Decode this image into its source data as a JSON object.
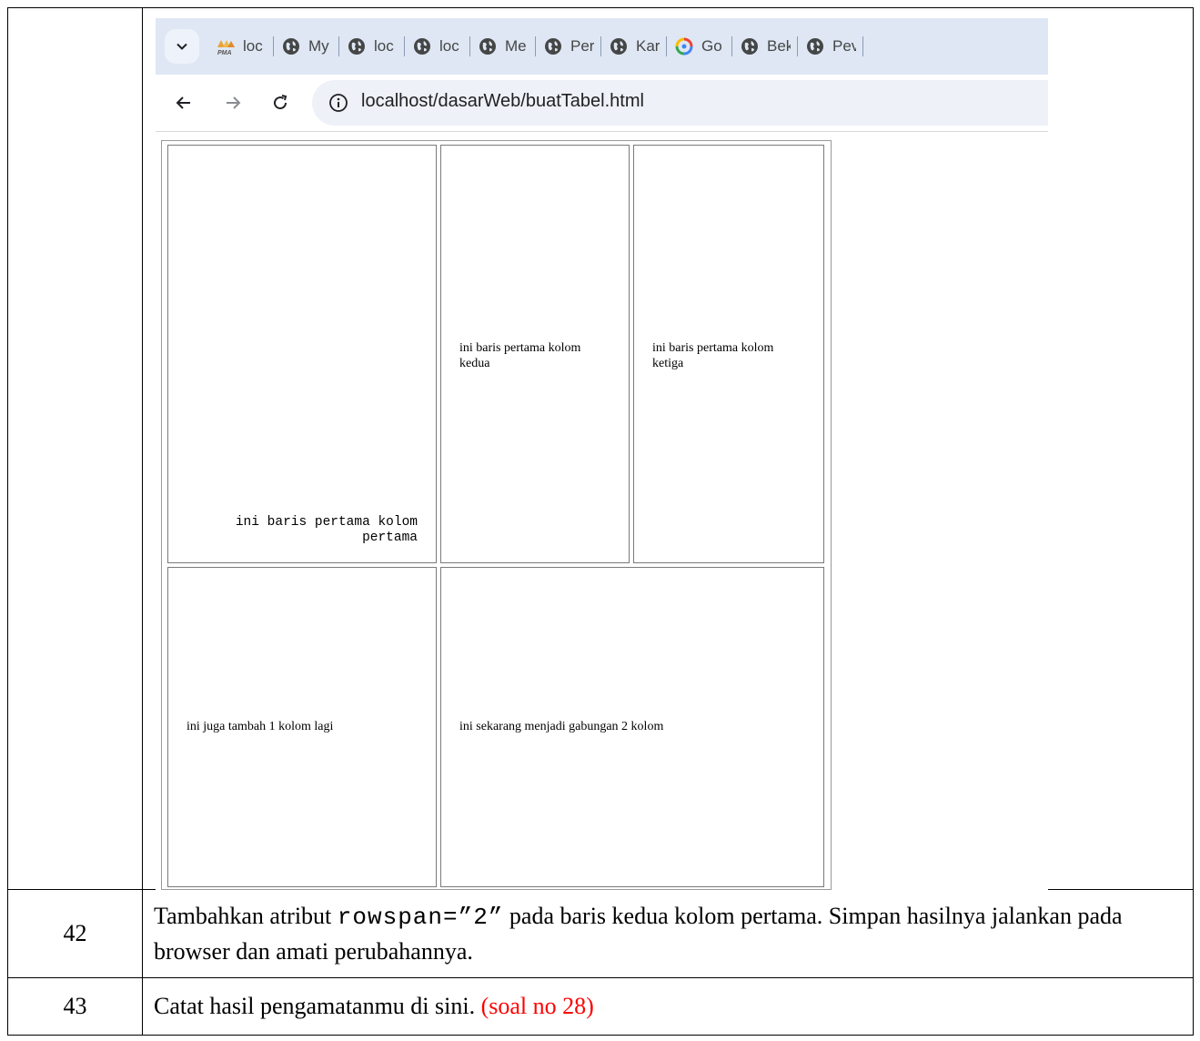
{
  "rows": [
    {
      "number": "",
      "kind": "screenshot"
    },
    {
      "number": "42",
      "text_before": "Tambahkan atribut ",
      "code": "rowspan=”2”",
      "text_after": " pada baris kedua kolom pertama. Simpan hasilnya jalankan pada browser dan amati perubahannya."
    },
    {
      "number": "43",
      "text": "Catat hasil pengamatanmu di sini. ",
      "note": "(soal no 28)"
    }
  ],
  "browser": {
    "tabs": [
      {
        "icon": "pma-icon",
        "label": "loc"
      },
      {
        "icon": "globe-icon",
        "label": "My"
      },
      {
        "icon": "globe-icon",
        "label": "loc"
      },
      {
        "icon": "globe-icon",
        "label": "loc"
      },
      {
        "icon": "globe-icon",
        "label": "Me"
      },
      {
        "icon": "globe-icon",
        "label": "Per"
      },
      {
        "icon": "globe-icon",
        "label": "Kar"
      },
      {
        "icon": "google-icon",
        "label": "Go"
      },
      {
        "icon": "globe-icon",
        "label": "Bek"
      },
      {
        "icon": "globe-icon",
        "label": "Pev"
      }
    ],
    "url": "localhost/dasarWeb/buatTabel.html",
    "table": {
      "r1c1": "ini baris pertama kolom pertama",
      "r1c2": "ini baris pertama kolom kedua",
      "r1c3": "ini baris pertama kolom ketiga",
      "r2c1": "ini juga tambah 1 kolom lagi",
      "r2c2": "ini sekarang menjadi gabungan 2 kolom"
    }
  },
  "colors": {
    "note": "#ff0000",
    "tabstrip": "#dfe7f4",
    "omnibox": "#eef1f7"
  }
}
